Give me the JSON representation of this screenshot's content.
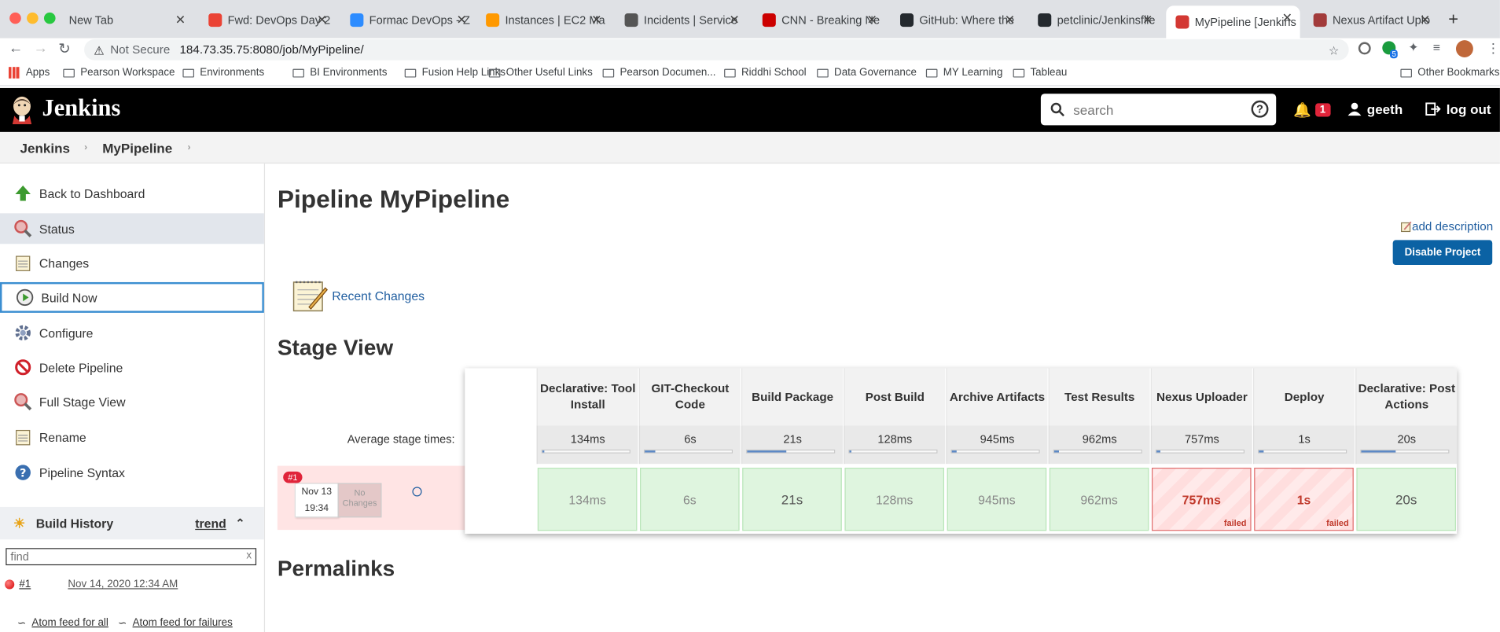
{
  "browser": {
    "tabs": [
      {
        "title": "New Tab",
        "color": "#dfe1e5"
      },
      {
        "title": "Fwd: DevOps Day 2",
        "color": "#ea4335"
      },
      {
        "title": "Formac DevOps - Z",
        "color": "#2d8cff"
      },
      {
        "title": "Instances | EC2 Ma",
        "color": "#f90"
      },
      {
        "title": "Incidents | Service",
        "color": "#555"
      },
      {
        "title": "CNN - Breaking Ne",
        "color": "#cc0000"
      },
      {
        "title": "GitHub: Where the",
        "color": "#24292e"
      },
      {
        "title": "petclinic/Jenkinsfile",
        "color": "#24292e"
      },
      {
        "title": "MyPipeline [Jenkins",
        "color": "#d33833"
      },
      {
        "title": "Nexus Artifact Uplo",
        "color": "#a23b3b"
      }
    ],
    "not_secure": "Not Secure",
    "url": "184.73.35.75:8080/job/MyPipeline/",
    "extension_badge": "5",
    "bookmarks": [
      "Apps",
      "Pearson Workspace",
      "Environments",
      "BI Environments",
      "Fusion Help Links",
      "Other Useful Links",
      "Pearson Documen...",
      "Riddhi School",
      "Data Governance",
      "MY Learning",
      "Tableau"
    ],
    "other_bookmarks": "Other Bookmarks"
  },
  "header": {
    "brand": "Jenkins",
    "search_placeholder": "search",
    "notifications": "1",
    "user": "geeth",
    "logout": "log out"
  },
  "breadcrumb": [
    "Jenkins",
    "MyPipeline"
  ],
  "sidebar": {
    "items": [
      "Back to Dashboard",
      "Status",
      "Changes",
      "Build Now",
      "Configure",
      "Delete Pipeline",
      "Full Stage View",
      "Rename",
      "Pipeline Syntax"
    ],
    "build_history": "Build History",
    "trend": "trend",
    "find_placeholder": "find",
    "find_clear": "x",
    "builds": [
      {
        "number": "#1",
        "date": "Nov 14, 2020 12:34 AM",
        "status": "failed"
      }
    ],
    "atom_all": "Atom feed for all",
    "atom_failures": "Atom feed for failures"
  },
  "main": {
    "title": "Pipeline MyPipeline",
    "add_description": "add description",
    "disable_button": "Disable Project",
    "recent_changes": "Recent Changes",
    "stage_view": "Stage View",
    "permalinks": "Permalinks"
  },
  "stage_view": {
    "average_label": "Average stage times:",
    "stages": [
      {
        "name": "Declarative: Tool Install",
        "avg": "134ms",
        "bar": 0.02,
        "result": "134ms",
        "status": "success"
      },
      {
        "name": "GIT-Checkout Code",
        "avg": "6s",
        "bar": 0.12,
        "result": "6s",
        "status": "success"
      },
      {
        "name": "Build Package",
        "avg": "21s",
        "bar": 0.45,
        "result": "21s",
        "status": "success"
      },
      {
        "name": "Post Build",
        "avg": "128ms",
        "bar": 0.02,
        "result": "128ms",
        "status": "success"
      },
      {
        "name": "Archive Artifacts",
        "avg": "945ms",
        "bar": 0.05,
        "result": "945ms",
        "status": "success"
      },
      {
        "name": "Test Results",
        "avg": "962ms",
        "bar": 0.05,
        "result": "962ms",
        "status": "success"
      },
      {
        "name": "Nexus Uploader",
        "avg": "757ms",
        "bar": 0.04,
        "result": "757ms",
        "status": "failed"
      },
      {
        "name": "Deploy",
        "avg": "1s",
        "bar": 0.06,
        "result": "1s",
        "status": "failed"
      },
      {
        "name": "Declarative: Post Actions",
        "avg": "20s",
        "bar": 0.4,
        "result": "20s",
        "status": "success"
      }
    ],
    "failed_label": "failed",
    "build": {
      "number": "#1",
      "date": "Nov 13",
      "time": "19:34",
      "changes": "No Changes"
    }
  }
}
